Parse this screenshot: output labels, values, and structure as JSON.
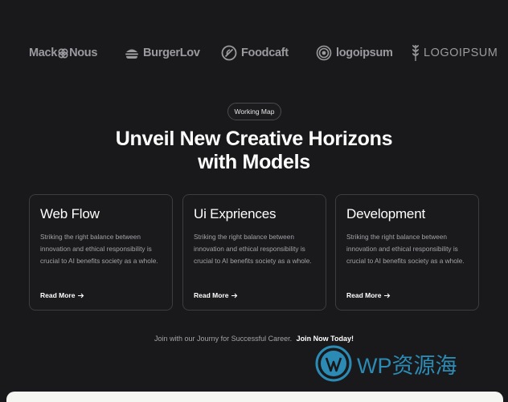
{
  "logos": {
    "mack": "Mack",
    "nous": "Nous",
    "burgerlov": "BurgerLov",
    "foodcaft": "Foodcaft",
    "logoipsum_lower": "logoipsum",
    "logoipsum_upper": "LOGOIPSUM"
  },
  "hero": {
    "pill_label": "Working Map",
    "title_line1": "Unveil New Creative Horizons",
    "title_line2": "with Models"
  },
  "cards": [
    {
      "title": "Web Flow",
      "body": "Striking the right balance between innovation and ethical responsibility is crucial to AI benefits society as a whole.",
      "link": "Read More"
    },
    {
      "title": "Ui Expriences",
      "body": "Striking the right balance between innovation and ethical responsibility is crucial to AI benefits society as a whole.",
      "link": "Read More"
    },
    {
      "title": "Development",
      "body": "Striking the right balance between innovation and ethical responsibility is crucial to AI benefits society as a whole.",
      "link": "Read More"
    }
  ],
  "footer": {
    "text": "Join with our Journy for Successful Career.",
    "link": "Join Now Today!"
  },
  "watermark": {
    "text": "WP资源海",
    "icon": "wordpress-icon",
    "color": "#2c8bb5"
  },
  "colors": {
    "background": "#19191b",
    "card_border": "#3c3c41",
    "muted_text": "#a3a3a8",
    "logo_gray": "#9a9a9f"
  }
}
